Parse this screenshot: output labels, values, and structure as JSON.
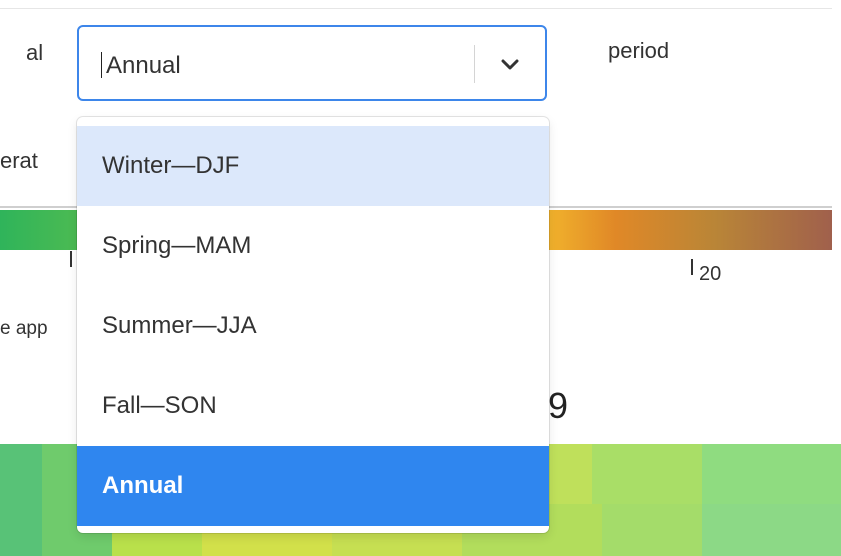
{
  "fragments": {
    "left_label_partial": "al",
    "period_label": "period",
    "left_row2_partial": "erat",
    "left_row4_partial": "e app",
    "big_digit_partial": "9"
  },
  "select": {
    "value": "Annual"
  },
  "icons": {
    "dropdown_indicator": "chevron-down-icon"
  },
  "menu": {
    "options": [
      {
        "label": "Winter—DJF",
        "state": "focused"
      },
      {
        "label": "Spring—MAM",
        "state": "normal"
      },
      {
        "label": "Summer—JJA",
        "state": "normal"
      },
      {
        "label": "Fall—SON",
        "state": "normal"
      },
      {
        "label": "Annual",
        "state": "selected"
      }
    ]
  },
  "legend": {
    "tick_labels": [
      "20"
    ]
  },
  "colors": {
    "accent": "#2f86ef",
    "focus_border": "#3d86ea",
    "focused_option": "#dce8fb"
  }
}
